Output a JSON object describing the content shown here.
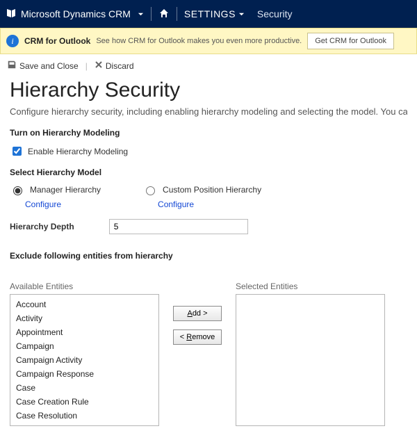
{
  "topnav": {
    "product": "Microsoft Dynamics CRM",
    "area": "SETTINGS",
    "crumb": "Security"
  },
  "notice": {
    "title": "CRM for Outlook",
    "message": "See how CRM for Outlook makes you even more productive.",
    "button": "Get CRM for Outlook"
  },
  "toolbar": {
    "save_close": "Save and Close",
    "discard": "Discard"
  },
  "page": {
    "title": "Hierarchy Security",
    "intro": "Configure hierarchy security, including enabling hierarchy modeling and selecting the model. You can also specify h"
  },
  "hier": {
    "section_turn_on": "Turn on Hierarchy Modeling",
    "enable_label": "Enable Hierarchy Modeling",
    "enable_checked": true,
    "section_model": "Select Hierarchy Model",
    "opt_manager": "Manager Hierarchy",
    "opt_custom": "Custom Position Hierarchy",
    "selected_model": "manager",
    "configure": "Configure",
    "depth_label": "Hierarchy Depth",
    "depth_value": "5"
  },
  "exclude": {
    "section": "Exclude following entities from hierarchy",
    "available_label": "Available Entities",
    "selected_label": "Selected Entities",
    "available": [
      "Account",
      "Activity",
      "Appointment",
      "Campaign",
      "Campaign Activity",
      "Campaign Response",
      "Case",
      "Case Creation Rule",
      "Case Resolution"
    ],
    "selected": [],
    "add": "Add >",
    "remove": "< Remove"
  }
}
